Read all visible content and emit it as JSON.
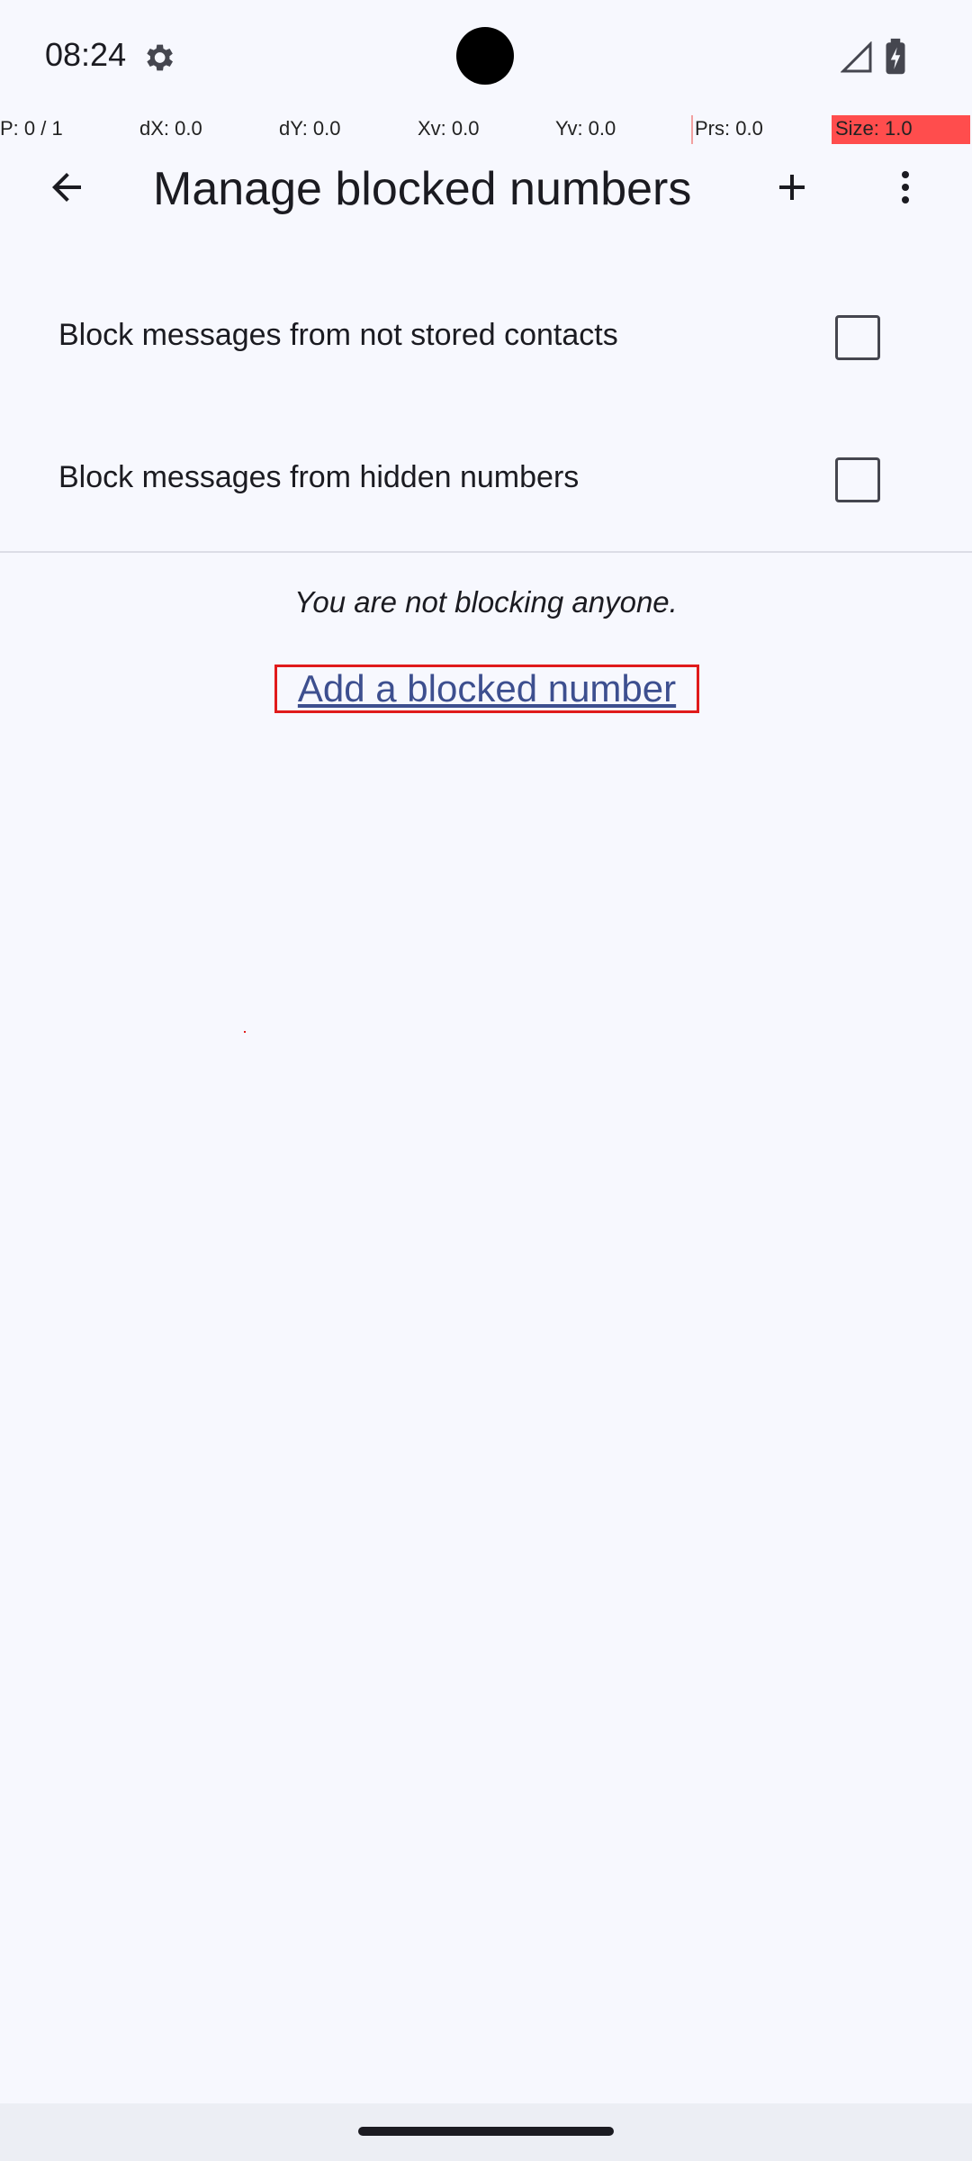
{
  "status_bar": {
    "time": "08:24",
    "settings_icon": "gear-icon",
    "signal_icon": "cell-signal-icon",
    "battery_icon": "battery-charging-icon"
  },
  "pointer_overlay": {
    "p": "P: 0 / 1",
    "dx": "dX: 0.0",
    "dy": "dY: 0.0",
    "xv": "Xv: 0.0",
    "yv": "Yv: 0.0",
    "prs": "Prs: 0.0",
    "size": "Size: 1.0"
  },
  "app_bar": {
    "title": "Manage blocked numbers",
    "back_icon": "arrow-back-icon",
    "add_icon": "plus-icon",
    "more_icon": "more-vert-icon"
  },
  "settings": [
    {
      "label": "Block messages from not stored contacts",
      "checked": false
    },
    {
      "label": "Block messages from hidden numbers",
      "checked": false
    }
  ],
  "empty_state": {
    "message": "You are not blocking anyone.",
    "action_label": "Add a blocked number"
  },
  "colors": {
    "background": "#f7f8fe",
    "link": "#3d4f8f",
    "highlight": "#e01b1b"
  }
}
